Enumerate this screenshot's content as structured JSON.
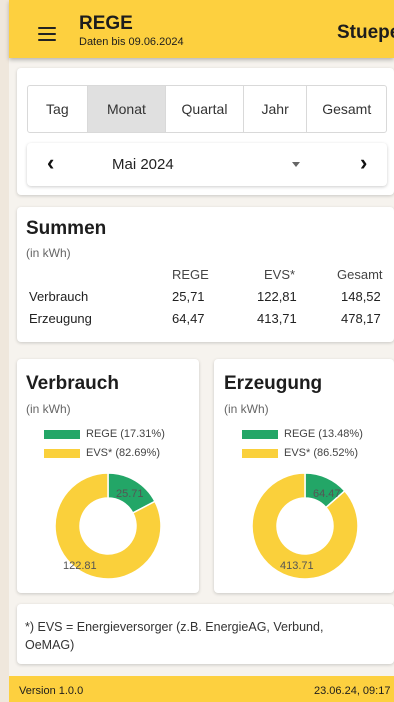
{
  "app": {
    "title": "REGE",
    "subtitle": "Daten bis 09.06.2024",
    "location": "Stuepe",
    "menu_icon": "hamburger-menu-icon"
  },
  "period_tabs": [
    {
      "label": "Tag",
      "active": false
    },
    {
      "label": "Monat",
      "active": true
    },
    {
      "label": "Quartal",
      "active": false
    },
    {
      "label": "Jahr",
      "active": false
    },
    {
      "label": "Gesamt",
      "active": false
    }
  ],
  "period_selector": {
    "value": "Mai 2024",
    "prev_icon": "chevron-left-icon",
    "next_icon": "chevron-right-icon",
    "dropdown_icon": "caret-down-icon"
  },
  "summen": {
    "title": "Summen",
    "unit": "(in kWh)",
    "columns": [
      "REGE",
      "EVS*",
      "Gesamt"
    ],
    "rows": [
      {
        "label": "Verbrauch",
        "values": [
          "25,71",
          "122,81",
          "148,52"
        ]
      },
      {
        "label": "Erzeugung",
        "values": [
          "64,47",
          "413,71",
          "478,17"
        ]
      }
    ]
  },
  "colors": {
    "rege": "#23a667",
    "evs": "#fad03b",
    "accent": "#fdd03f"
  },
  "verbrauch": {
    "title": "Verbrauch",
    "unit": "(in kWh)",
    "legend": [
      "REGE (17.31%)",
      "EVS* (82.69%)"
    ],
    "labels": [
      "25.71",
      "122.81"
    ]
  },
  "erzeugung": {
    "title": "Erzeugung",
    "unit": "(in kWh)",
    "legend": [
      "REGE (13.48%)",
      "EVS* (86.52%)"
    ],
    "labels": [
      "64.47",
      "413.71"
    ]
  },
  "chart_data": [
    {
      "type": "pie",
      "categories": [
        "REGE",
        "EVS*"
      ],
      "values": [
        25.71,
        122.81
      ],
      "title": "Verbrauch",
      "subtitle": "(in kWh)"
    },
    {
      "type": "pie",
      "categories": [
        "REGE",
        "EVS*"
      ],
      "values": [
        64.47,
        413.71
      ],
      "title": "Erzeugung",
      "subtitle": "(in kWh)"
    }
  ],
  "footnote": "*) EVS = Energieversorger (z.B. EnergieAG, Verbund, OeMAG)",
  "footer": {
    "version": "Version 1.0.0",
    "timestamp": "23.06.24, 09:17"
  }
}
